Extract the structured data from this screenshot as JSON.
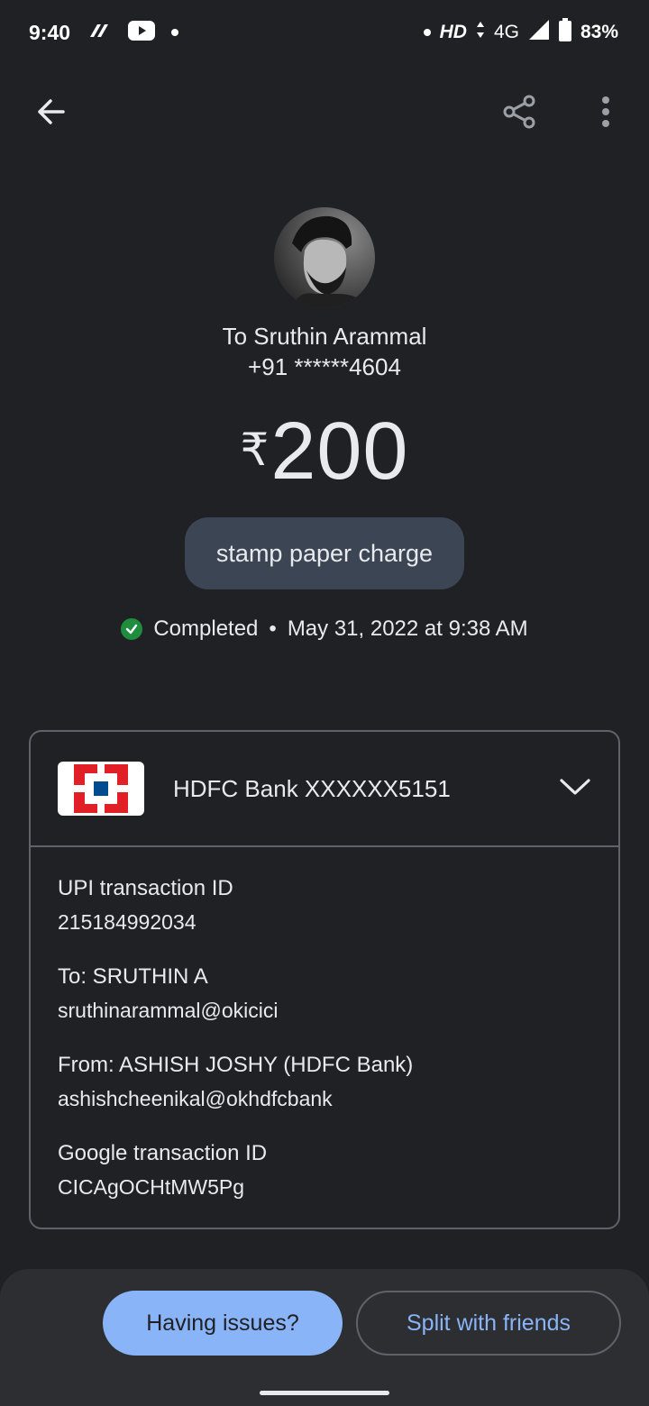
{
  "status_bar": {
    "time": "9:40",
    "network_hd": "HD",
    "network_type": "4G",
    "battery": "83%",
    "icons": [
      "app-icon",
      "youtube-icon",
      "notification-dot-icon",
      "dot-icon",
      "data-arrows-icon",
      "signal-icon",
      "battery-icon"
    ]
  },
  "top_bar": {
    "icons": [
      "back-arrow-icon",
      "share-icon",
      "more-vert-icon"
    ]
  },
  "recipient": {
    "name": "To Sruthin Arammal",
    "phone": "+91 ******4604"
  },
  "payment": {
    "currency_symbol": "₹",
    "amount": "200",
    "note": "stamp paper charge",
    "status": "Completed",
    "separator": "•",
    "datetime": "May 31, 2022 at 9:38 AM",
    "status_color": "#1e8e3e"
  },
  "card": {
    "bank_account": "HDFC Bank XXXXXX5151",
    "details": [
      {
        "label": "UPI transaction ID",
        "value": "215184992034"
      },
      {
        "label": "To: SRUTHIN A",
        "value": "sruthinarammal@okicici"
      },
      {
        "label": "From: ASHISH JOSHY (HDFC Bank)",
        "value": "ashishcheenikal@okhdfcbank"
      },
      {
        "label": "Google transaction ID",
        "value": "CICAgOCHtMW5Pg"
      }
    ]
  },
  "actions": {
    "issues_label": "Having issues?",
    "split_label": "Split with friends"
  },
  "colors": {
    "background": "#202124",
    "accent": "#8ab4f8",
    "chip": "#3c4554",
    "hdfc_red": "#e01f26",
    "hdfc_blue": "#004c8f"
  }
}
